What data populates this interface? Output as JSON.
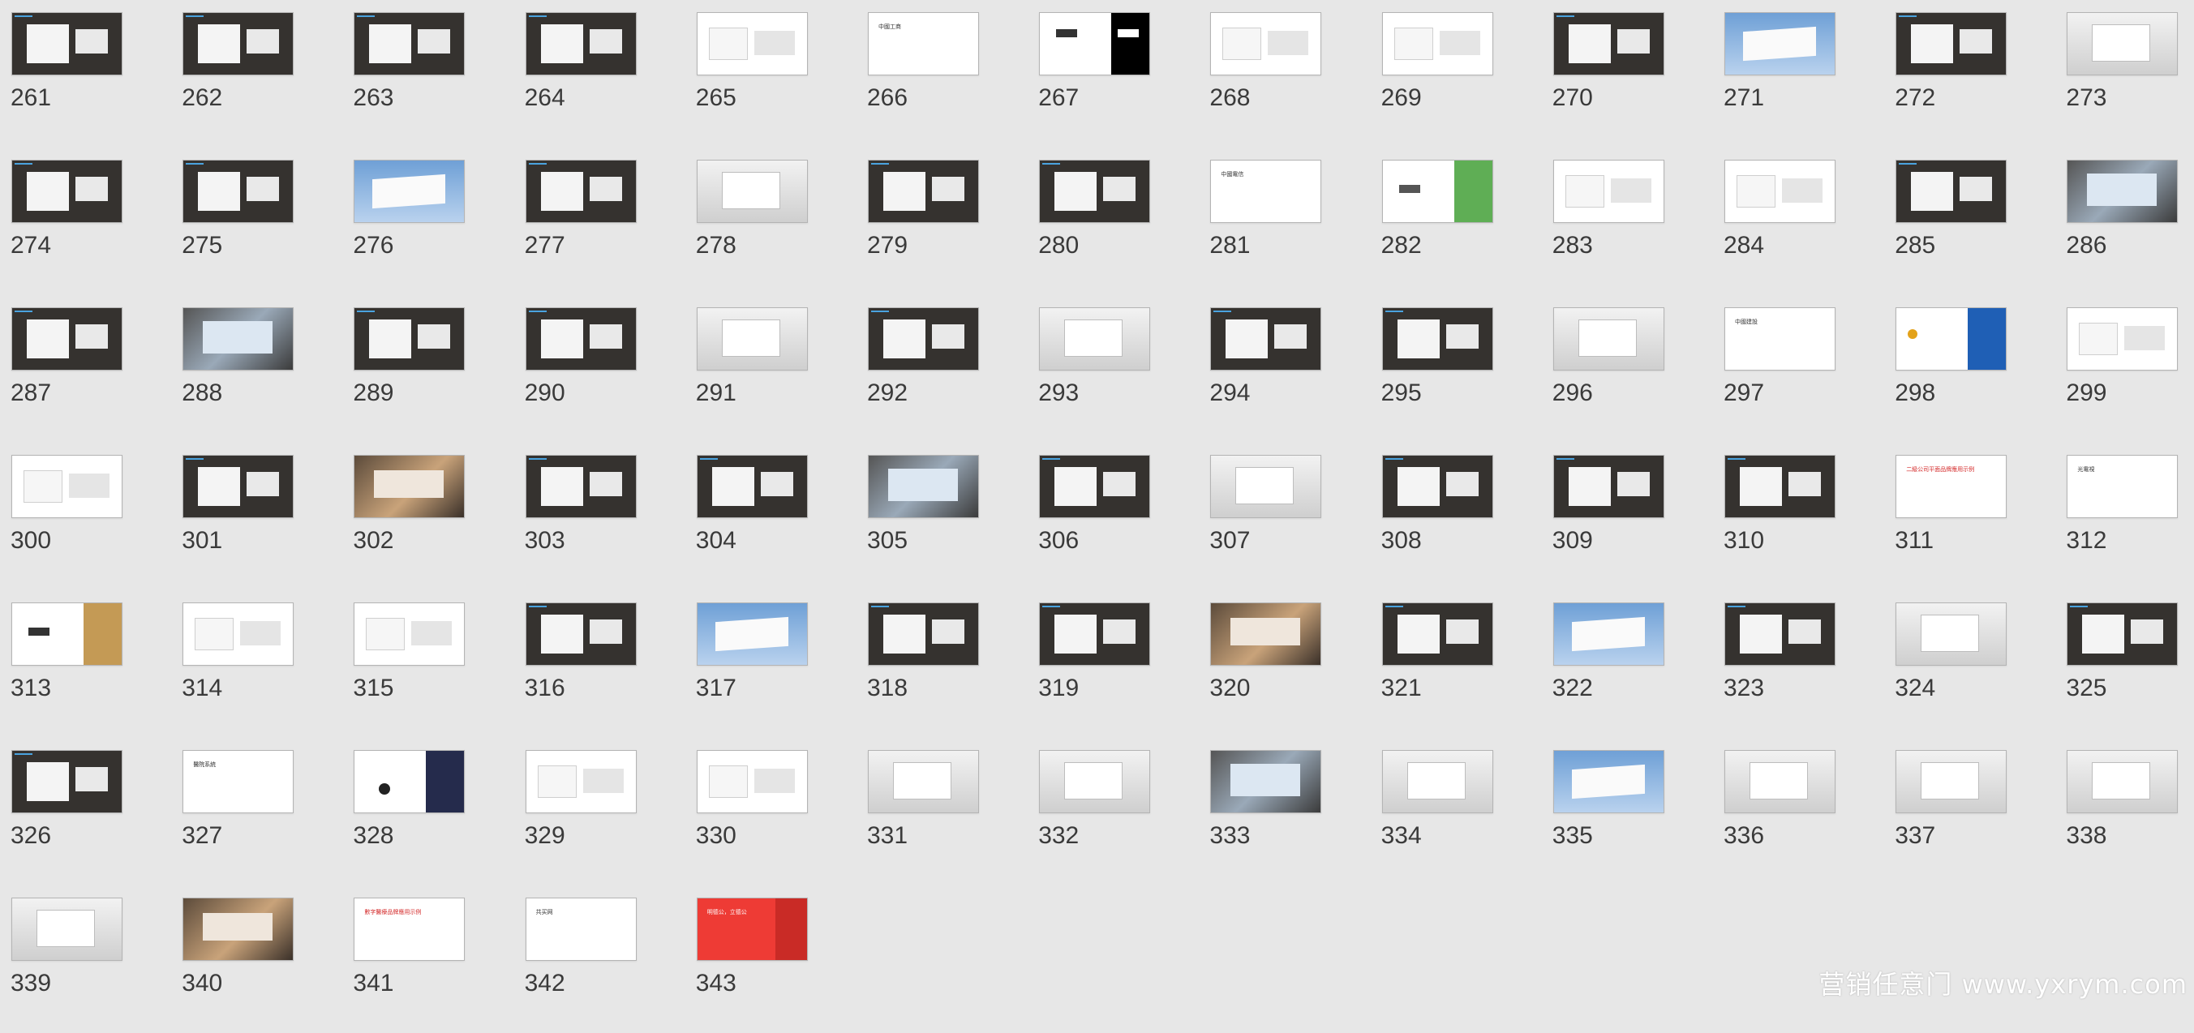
{
  "slides": [
    {
      "number": "261",
      "theme": "dark"
    },
    {
      "number": "262",
      "theme": "dark"
    },
    {
      "number": "263",
      "theme": "dark"
    },
    {
      "number": "264",
      "theme": "dark"
    },
    {
      "number": "265",
      "theme": "white"
    },
    {
      "number": "266",
      "theme": "white",
      "caption": "中國工商"
    },
    {
      "number": "267",
      "theme": "split-black"
    },
    {
      "number": "268",
      "theme": "white"
    },
    {
      "number": "269",
      "theme": "white"
    },
    {
      "number": "270",
      "theme": "dark"
    },
    {
      "number": "271",
      "theme": "sky"
    },
    {
      "number": "272",
      "theme": "dark"
    },
    {
      "number": "273",
      "theme": "gray"
    },
    {
      "number": "274",
      "theme": "dark"
    },
    {
      "number": "275",
      "theme": "dark"
    },
    {
      "number": "276",
      "theme": "sky"
    },
    {
      "number": "277",
      "theme": "dark"
    },
    {
      "number": "278",
      "theme": "gray"
    },
    {
      "number": "279",
      "theme": "dark"
    },
    {
      "number": "280",
      "theme": "dark"
    },
    {
      "number": "281",
      "theme": "white",
      "caption": "中國電信"
    },
    {
      "number": "282",
      "theme": "split-green"
    },
    {
      "number": "283",
      "theme": "white"
    },
    {
      "number": "284",
      "theme": "white"
    },
    {
      "number": "285",
      "theme": "dark"
    },
    {
      "number": "286",
      "theme": "photo"
    },
    {
      "number": "287",
      "theme": "dark"
    },
    {
      "number": "288",
      "theme": "photo"
    },
    {
      "number": "289",
      "theme": "dark"
    },
    {
      "number": "290",
      "theme": "dark"
    },
    {
      "number": "291",
      "theme": "gray"
    },
    {
      "number": "292",
      "theme": "dark"
    },
    {
      "number": "293",
      "theme": "gray"
    },
    {
      "number": "294",
      "theme": "dark"
    },
    {
      "number": "295",
      "theme": "dark"
    },
    {
      "number": "296",
      "theme": "gray"
    },
    {
      "number": "297",
      "theme": "white",
      "caption": "中國建設"
    },
    {
      "number": "298",
      "theme": "split-blue"
    },
    {
      "number": "299",
      "theme": "white"
    },
    {
      "number": "300",
      "theme": "white"
    },
    {
      "number": "301",
      "theme": "dark"
    },
    {
      "number": "302",
      "theme": "photo-warm"
    },
    {
      "number": "303",
      "theme": "dark"
    },
    {
      "number": "304",
      "theme": "dark"
    },
    {
      "number": "305",
      "theme": "photo"
    },
    {
      "number": "306",
      "theme": "dark"
    },
    {
      "number": "307",
      "theme": "gray"
    },
    {
      "number": "308",
      "theme": "dark"
    },
    {
      "number": "309",
      "theme": "dark"
    },
    {
      "number": "310",
      "theme": "dark"
    },
    {
      "number": "311",
      "theme": "white",
      "caption": "二級公司平面品牌應用示例",
      "caption_style": "red"
    },
    {
      "number": "312",
      "theme": "white",
      "caption": "光電視"
    },
    {
      "number": "313",
      "theme": "split-gold"
    },
    {
      "number": "314",
      "theme": "white"
    },
    {
      "number": "315",
      "theme": "white"
    },
    {
      "number": "316",
      "theme": "dark"
    },
    {
      "number": "317",
      "theme": "sky"
    },
    {
      "number": "318",
      "theme": "dark"
    },
    {
      "number": "319",
      "theme": "dark"
    },
    {
      "number": "320",
      "theme": "photo-warm"
    },
    {
      "number": "321",
      "theme": "dark"
    },
    {
      "number": "322",
      "theme": "sky"
    },
    {
      "number": "323",
      "theme": "dark"
    },
    {
      "number": "324",
      "theme": "gray"
    },
    {
      "number": "325",
      "theme": "dark"
    },
    {
      "number": "326",
      "theme": "dark"
    },
    {
      "number": "327",
      "theme": "white",
      "caption": "醫院系統"
    },
    {
      "number": "328",
      "theme": "split-navy"
    },
    {
      "number": "329",
      "theme": "white"
    },
    {
      "number": "330",
      "theme": "white"
    },
    {
      "number": "331",
      "theme": "gray"
    },
    {
      "number": "332",
      "theme": "gray"
    },
    {
      "number": "333",
      "theme": "photo"
    },
    {
      "number": "334",
      "theme": "gray"
    },
    {
      "number": "335",
      "theme": "sky"
    },
    {
      "number": "336",
      "theme": "gray"
    },
    {
      "number": "337",
      "theme": "gray"
    },
    {
      "number": "338",
      "theme": "gray"
    },
    {
      "number": "339",
      "theme": "gray"
    },
    {
      "number": "340",
      "theme": "photo-warm"
    },
    {
      "number": "341",
      "theme": "white",
      "caption": "數字醫療品牌應用示例",
      "caption_style": "red"
    },
    {
      "number": "342",
      "theme": "white",
      "caption": "共买网"
    },
    {
      "number": "343",
      "theme": "red",
      "caption": "明德公，立德公",
      "caption_style": "light"
    }
  ],
  "watermark": "营销任意门  www.yxrym.com",
  "colors": {
    "page_bg": "#e7e7e7",
    "dark": "#35322f",
    "white": "#ffffff",
    "red": "#ee3b35",
    "green": "#5fae55",
    "blue": "#1f5fb5",
    "gold": "#c49a55",
    "navy": "#252b4c",
    "sky": "#8fb3dd",
    "number_text": "#3a3a3a"
  }
}
